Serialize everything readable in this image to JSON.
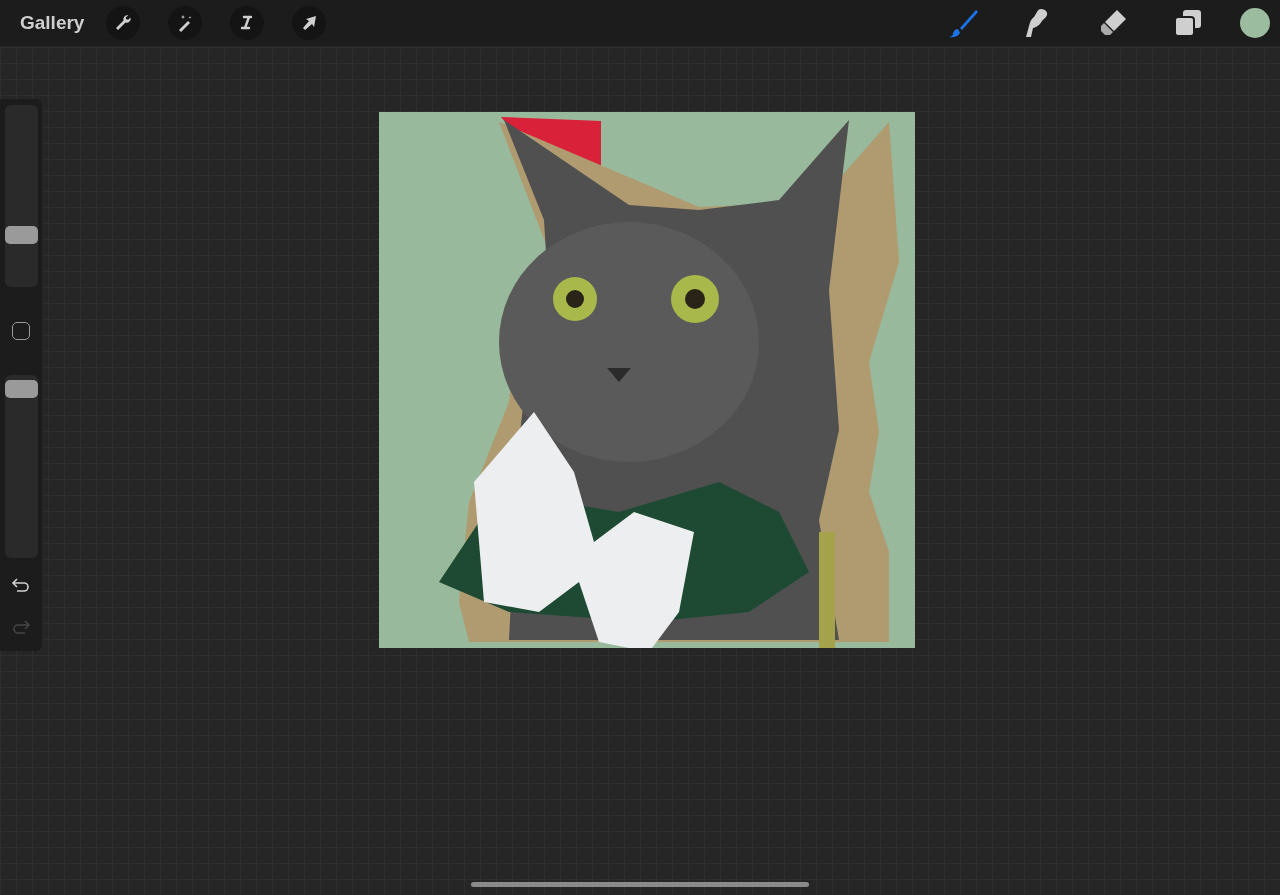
{
  "toolbar": {
    "gallery": "Gallery",
    "left_tools": [
      {
        "kind": "wrench"
      },
      {
        "kind": "wand"
      },
      {
        "kind": "selection"
      },
      {
        "kind": "move"
      }
    ],
    "right_tools": [
      {
        "kind": "brush",
        "selected": true
      },
      {
        "kind": "smudge",
        "selected": false
      },
      {
        "kind": "eraser",
        "selected": false
      },
      {
        "kind": "layers",
        "selected": false
      }
    ],
    "color": "#9bbc9e"
  },
  "sidebar": {
    "size_slider": {
      "level": 0.26
    },
    "opacity_slider": {
      "level": 0.97
    },
    "undo": {
      "disabled": false
    },
    "redo": {
      "disabled": true
    }
  }
}
